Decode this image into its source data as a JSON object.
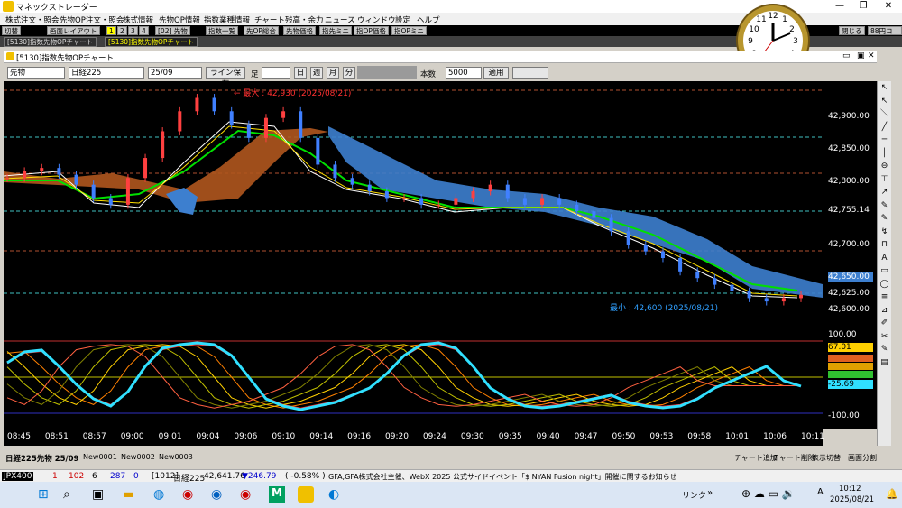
{
  "app": {
    "title": "マネックストレーダー"
  },
  "menu": [
    "株式注文・照会",
    "先物OP注文・照会",
    "株式情報",
    "先物OP情報",
    "指数業種情報",
    "チャート",
    "残高・余力",
    "ニュース",
    "ウィンドウ",
    "設定",
    "ヘルプ"
  ],
  "toolbar": {
    "b0": "切替",
    "b1": "画面レイアウト",
    "b2": "1",
    "b3": "2",
    "b4": "3",
    "b5": "4",
    "b6": "[02] 先物",
    "b7": "指数一覧",
    "b8": "先OP総合",
    "b9": "先物価格",
    "b10": "指先ミニ",
    "b11": "指OP価格",
    "b12": "指OPミニ",
    "b13": "閉じる",
    "b14": "88円コー"
  },
  "tabs": [
    "[5130]指数先物OPチャート",
    "[5130]指数先物OPチャート"
  ],
  "chart_window": {
    "title": "[5130]指数先物OPチャート"
  },
  "controls": {
    "type": "先物",
    "index": "日経225",
    "month": "25/09",
    "line_save": "ライン保存",
    "foot": "足",
    "unit_day": "日",
    "unit_week": "週",
    "unit_month": "月",
    "unit_min": "分",
    "count_label": "本数",
    "count": "5000",
    "apply": "適用"
  },
  "annotations": {
    "max": "← 最大 : 42,930 (2025/08/21)",
    "min": "最小 : 42,600 (2025/08/21)"
  },
  "y_ticks": [
    "42,900.00",
    "42,850.00",
    "42,800.00",
    "42,755.14",
    "42,700.00",
    "42,650.00",
    "42,625.00",
    "42,600.00"
  ],
  "osc_ticks": {
    "top": "100.00",
    "bottom": "-100.00",
    "v1": "67.01",
    "v2": "-25.69"
  },
  "x_ticks": [
    "08:45",
    "08:51",
    "08:57",
    "09:00",
    "09:01",
    "09:04",
    "09:06",
    "09:10",
    "09:14",
    "09:16",
    "09:20",
    "09:24",
    "09:30",
    "09:35",
    "09:40",
    "09:47",
    "09:50",
    "09:53",
    "09:58",
    "10:01",
    "10:06",
    "10:11"
  ],
  "bottom_tabs": [
    "日経225先物 25/09",
    "New0001",
    "New0002",
    "New0003"
  ],
  "bottom_buttons": [
    "チャート追加",
    "チャート削除",
    "表示切替",
    "画面分割"
  ],
  "status": {
    "jpx": "JPX400",
    "n1": "1",
    "n2": "102",
    "n3": "6",
    "n4": "287",
    "n5": "0",
    "code": "[1012]",
    "name": "日経225",
    "price": "42,641.76",
    "chg": "▼246.79",
    "pct": "( -0.58% )",
    "news": "GFA,GFA株式会社主催、WebX 2025 公式サイドイベント「$ NYAN Fusion night」開催に関するお知らせ"
  },
  "taskbar": {
    "link": "リンク",
    "time": "10:12",
    "date": "2025/08/21"
  },
  "colors": {
    "bg": "#000000",
    "cloud_blue": "#3d7fcf",
    "cloud_brown": "#b0561e",
    "ma_green": "#00e000",
    "osc_cyan": "#30e0ff"
  },
  "chart_data": {
    "type": "line",
    "ylim": [
      42580,
      42945
    ],
    "close": [
      42800,
      42810,
      42815,
      42805,
      42790,
      42770,
      42760,
      42800,
      42830,
      42870,
      42900,
      42920,
      42900,
      42880,
      42860,
      42890,
      42900,
      42860,
      42820,
      42800,
      42790,
      42780,
      42770,
      42770,
      42760,
      42760,
      42770,
      42780,
      42790,
      42770,
      42760,
      42770,
      42760,
      42750,
      42740,
      42720,
      42700,
      42690,
      42680,
      42660,
      42650,
      42640,
      42630,
      42620,
      42615,
      42620,
      42625
    ],
    "osc": [
      40,
      70,
      75,
      30,
      -20,
      -60,
      -80,
      -40,
      30,
      80,
      90,
      95,
      90,
      60,
      0,
      -60,
      -80,
      -90,
      -80,
      -70,
      -50,
      -30,
      10,
      60,
      90,
      95,
      80,
      30,
      -30,
      -60,
      -80,
      -85,
      -80,
      -70,
      -60,
      -50,
      -70,
      -80,
      -85,
      -80,
      -60,
      -30,
      -10,
      10,
      30,
      -10,
      -25
    ]
  }
}
